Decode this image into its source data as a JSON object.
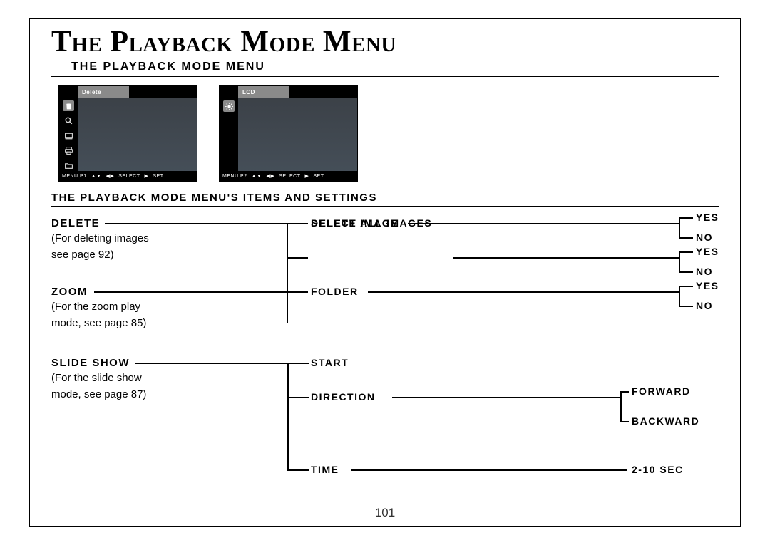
{
  "title": "The Playback Mode Menu",
  "section_header": "THE PLAYBACK MODE MENU",
  "section_header2": "THE PLAYBACK MODE MENU'S ITEMS AND SETTINGS",
  "lcd1": {
    "tab": "Delete",
    "menu": "MENU P1",
    "select": "SELECT",
    "set": "SET"
  },
  "lcd2": {
    "tab": "LCD",
    "menu": "MENU P2",
    "select": "SELECT",
    "set": "SET"
  },
  "tree": {
    "delete": {
      "title": "DELETE",
      "desc1": "(For deleting images",
      "desc2": "see page 92)"
    },
    "zoom": {
      "title": "ZOOM",
      "desc1": "(For the zoom play",
      "desc2": "mode, see page 85)"
    },
    "slideshow": {
      "title": "SLIDE SHOW",
      "desc1": "(For the slide show",
      "desc2": "mode, see page 87)"
    },
    "select_image": "SELECT IMAGE",
    "delete_all": "DELETE ALL IMAGES",
    "folder": "FOLDER",
    "start": "START",
    "direction": "DIRECTION",
    "time": "TIME",
    "yes": "YES",
    "no": "NO",
    "forward": "FORWARD",
    "backward": "BACKWARD",
    "time_range": "2-10 SEC"
  },
  "page_number": "101"
}
